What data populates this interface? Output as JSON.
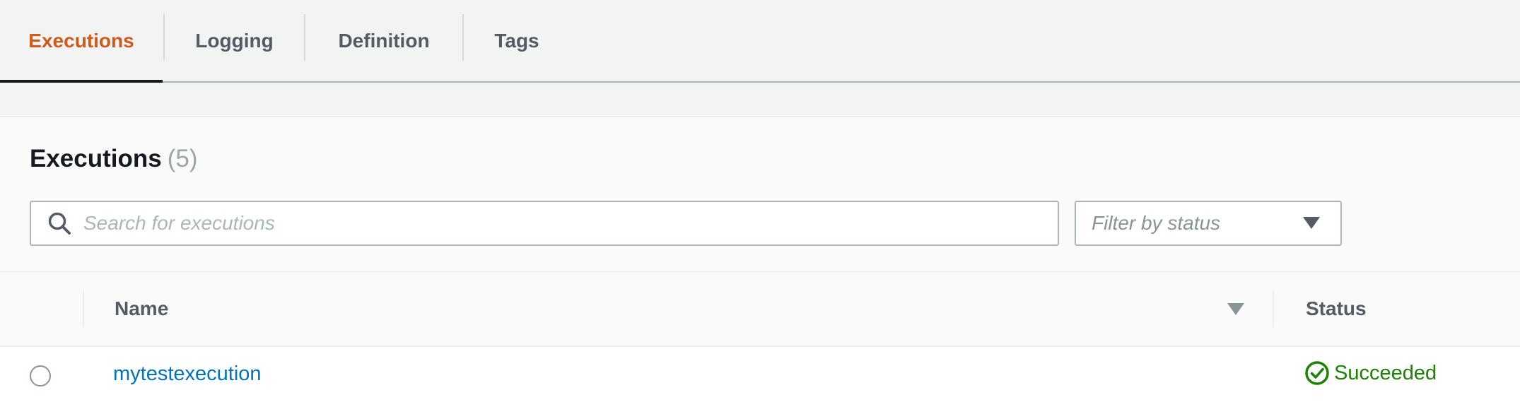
{
  "tabs": [
    {
      "label": "Executions",
      "active": true
    },
    {
      "label": "Logging",
      "active": false
    },
    {
      "label": "Definition",
      "active": false
    },
    {
      "label": "Tags",
      "active": false
    }
  ],
  "panel": {
    "title": "Executions",
    "count": "(5)"
  },
  "search": {
    "value": "",
    "placeholder": "Search for executions",
    "icon": "search-icon"
  },
  "filter": {
    "label": "Filter by status",
    "icon": "caret-down-icon"
  },
  "table": {
    "columns": [
      {
        "label": "Name",
        "sortable": true,
        "sort_icon": "sort-descending-icon"
      },
      {
        "label": "Status"
      }
    ],
    "rows": [
      {
        "name": "mytestexecution",
        "status": "Succeeded",
        "status_icon": "check-circle-icon",
        "selected": false
      }
    ]
  },
  "colors": {
    "active_tab": "#d05a1c",
    "link": "#0073bb",
    "success": "#1d8102",
    "text": "#16191f",
    "muted": "#545b64"
  }
}
